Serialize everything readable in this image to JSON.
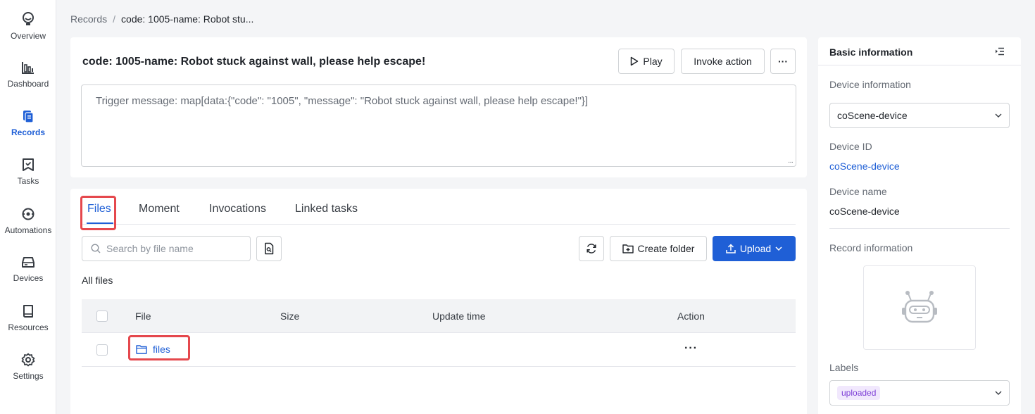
{
  "sidebar": {
    "items": [
      {
        "label": "Overview",
        "icon": "overview-icon"
      },
      {
        "label": "Dashboard",
        "icon": "dashboard-icon"
      },
      {
        "label": "Records",
        "icon": "records-icon",
        "active": true
      },
      {
        "label": "Tasks",
        "icon": "tasks-icon"
      },
      {
        "label": "Automations",
        "icon": "automations-icon"
      },
      {
        "label": "Devices",
        "icon": "devices-icon"
      },
      {
        "label": "Resources",
        "icon": "resources-icon"
      },
      {
        "label": "Settings",
        "icon": "settings-icon"
      }
    ]
  },
  "breadcrumb": {
    "root": "Records",
    "separator": "/",
    "current": "code: 1005-name: Robot stu..."
  },
  "record": {
    "title": "code: 1005-name: Robot stuck against wall, please help escape!",
    "play_label": "Play",
    "invoke_label": "Invoke action",
    "more_label": "···",
    "trigger_message": "Trigger message: map[data:{\"code\": \"1005\", \"message\": \"Robot stuck against wall, please help escape!\"}]"
  },
  "files": {
    "tabs": [
      {
        "label": "Files",
        "active": true
      },
      {
        "label": "Moment"
      },
      {
        "label": "Invocations"
      },
      {
        "label": "Linked tasks"
      }
    ],
    "search_placeholder": "Search by file name",
    "create_folder_label": "Create folder",
    "upload_label": "Upload",
    "section_title": "All files",
    "columns": [
      "File",
      "Size",
      "Update time",
      "Action"
    ],
    "rows": [
      {
        "name": "files",
        "size": "",
        "update_time": "",
        "action": "···"
      }
    ]
  },
  "panel": {
    "title": "Basic information",
    "device_info_label": "Device information",
    "device_select_value": "coScene-device",
    "device_id_label": "Device ID",
    "device_id_value": "coScene-device",
    "device_name_label": "Device name",
    "device_name_value": "coScene-device",
    "record_info_label": "Record information",
    "labels_label": "Labels",
    "labels_tag": "uploaded"
  },
  "colors": {
    "accent": "#1f5fd6",
    "highlight": "#e5484d",
    "tag_bg": "#f1e8fd",
    "tag_fg": "#7c3dd6"
  }
}
